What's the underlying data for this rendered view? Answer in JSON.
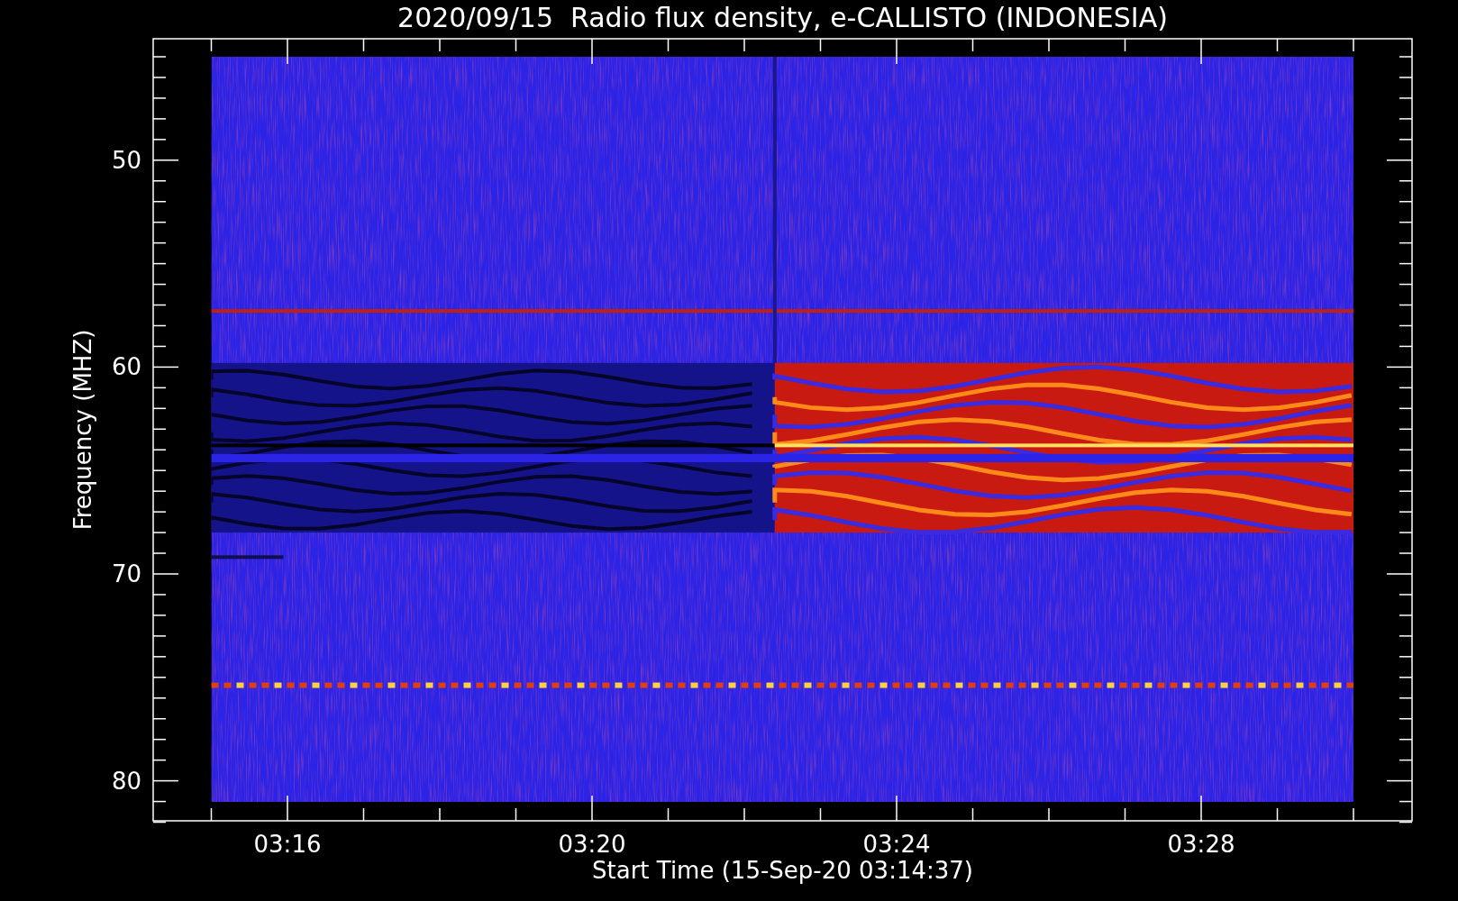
{
  "title": "2020/09/15  Radio flux density, e-CALLISTO (INDONESIA)",
  "ylabel": "Frequency (MHZ)",
  "xlabel": "Start Time (15-Sep-20 03:14:37)",
  "yticks": [
    {
      "label": "50"
    },
    {
      "label": "60"
    },
    {
      "label": "70"
    },
    {
      "label": "80"
    }
  ],
  "xticks": [
    {
      "label": "03:16"
    },
    {
      "label": "03:20"
    },
    {
      "label": "03:24"
    },
    {
      "label": "03:28"
    }
  ]
}
